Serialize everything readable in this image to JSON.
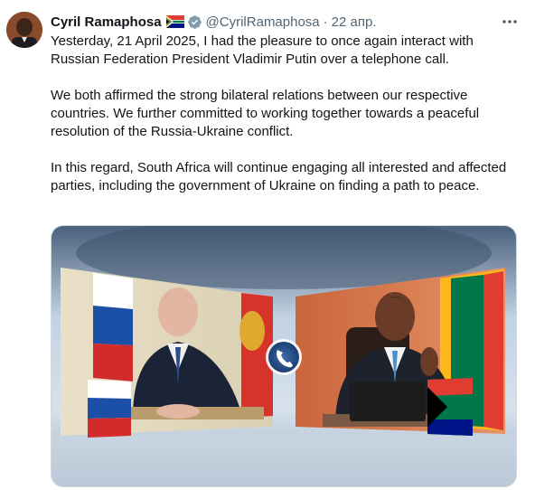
{
  "author": {
    "name": "Cyril Ramaphosa",
    "flag_icon": "south-africa-flag-icon",
    "verified_icon": "verified-badge-icon",
    "handle": "@CyrilRamaphosa",
    "separator": "·",
    "timestamp": "22 апр."
  },
  "tweet": {
    "paragraphs": [
      "Yesterday, 21 April 2025, I had the pleasure to once again interact with Russian Federation President Vladimir Putin over a telephone call.",
      "We both affirmed the strong bilateral relations between our respective countries. We further committed to working together towards a peaceful resolution of the Russia-Ukraine conflict.",
      "In this regard, South Africa will continue engaging all interested and affected parties, including the government of Ukraine on finding a path to peace."
    ]
  },
  "media": {
    "call_icon": "phone-call-icon"
  },
  "colors": {
    "text": "#0f1419",
    "secondary": "#536471",
    "verified": "#829aab"
  }
}
